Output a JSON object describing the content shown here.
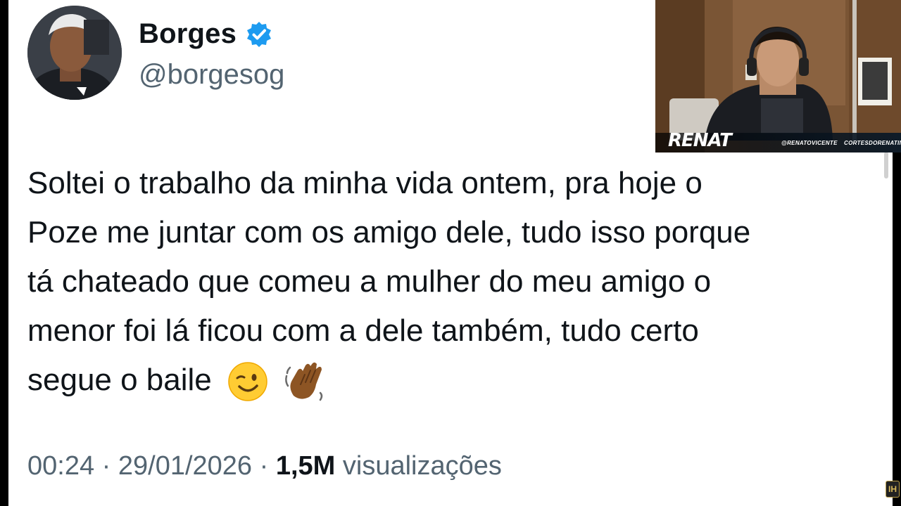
{
  "tweet": {
    "author_name": "Borges",
    "author_handle": "@borgesog",
    "text_lines": [
      "Soltei o trabalho da minha vida ontem, pra hoje o",
      "Poze me juntar com os amigo dele, tudo isso porque",
      "tá chateado que comeu a mulher do meu amigo o",
      "menor foi lá ficou com a dele também, tudo certo",
      "segue o baile"
    ],
    "emojis": [
      "wink-emoji",
      "waving-hand-emoji"
    ],
    "time": "00:24",
    "separator": "·",
    "date": "29/01/2026",
    "views_count": "1,5M",
    "views_label": "visualizações"
  },
  "webcam": {
    "logo": "RENAT",
    "handle_left": "@RENATOVICENTE",
    "handle_right": "CORTESDORENATIN"
  },
  "corner_logo": "IH",
  "colors": {
    "text_primary": "#0f1419",
    "text_secondary": "#536471",
    "verified_blue": "#1d9bf0"
  }
}
